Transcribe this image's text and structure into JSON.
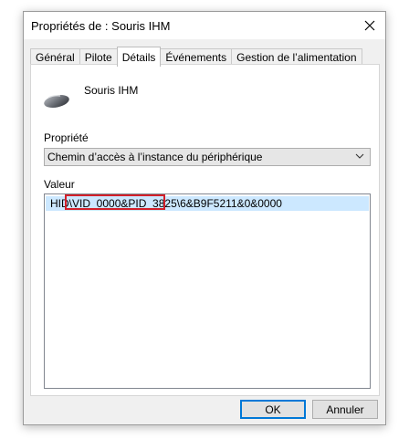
{
  "window": {
    "title": "Propriétés de : Souris IHM",
    "close_icon": "close-icon"
  },
  "tabs": [
    {
      "label": "Général"
    },
    {
      "label": "Pilote"
    },
    {
      "label": "Détails",
      "active": true
    },
    {
      "label": "Événements"
    },
    {
      "label": "Gestion de l’alimentation"
    }
  ],
  "device": {
    "icon": "mouse-icon",
    "name": "Souris IHM"
  },
  "property": {
    "label": "Propriété",
    "selected": "Chemin d’accès à l’instance du périphérique"
  },
  "value": {
    "label": "Valeur",
    "rows": [
      {
        "prefix": "HID\\",
        "highlighted": "VID_0000&PID_3825",
        "suffix": "\\6&B9F5211&0&0000"
      }
    ]
  },
  "buttons": {
    "ok": "OK",
    "cancel": "Annuler"
  },
  "colors": {
    "highlight_border": "#d2202a",
    "selected_row": "#cce8ff",
    "default_button_border": "#0078d7"
  }
}
